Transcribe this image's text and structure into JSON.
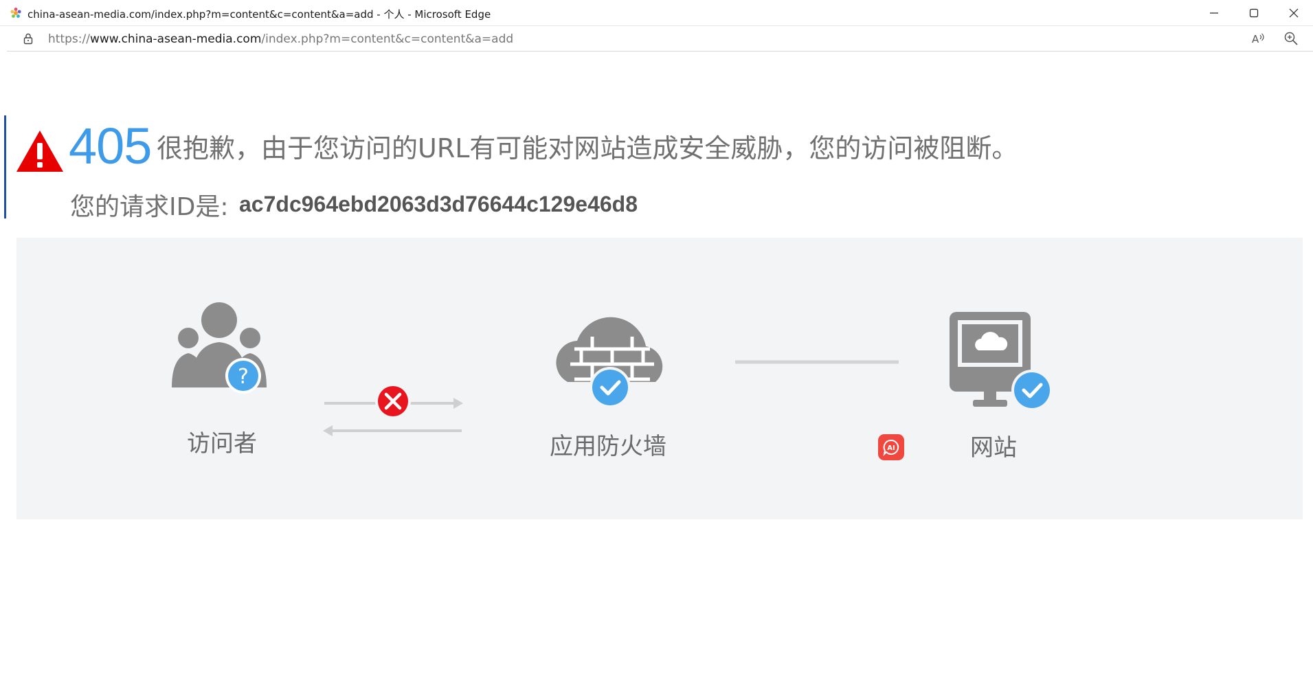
{
  "window": {
    "title": "china-asean-media.com/index.php?m=content&c=content&a=add - 个人 - Microsoft Edge"
  },
  "address_bar": {
    "url_scheme": "https://",
    "url_host": "www.china-asean-media.com",
    "url_path": "/index.php?m=content&c=content&a=add"
  },
  "error": {
    "code": "405",
    "message": "很抱歉，由于您访问的URL有可能对网站造成安全威胁，您的访问被阻断。",
    "request_id_label": "您的请求ID是:",
    "request_id": "ac7dc964ebd2063d3d76644c129e46d8"
  },
  "diagram": {
    "visitor_label": "访问者",
    "firewall_label": "应用防火墙",
    "website_label": "网站"
  },
  "icons": {
    "favicon": "edge-site-icon",
    "lock": "lock-icon",
    "read_aloud": "read-aloud-icon",
    "zoom": "zoom-icon",
    "warning": "warning-triangle-icon",
    "ai": "ai-assistant-icon"
  },
  "colors": {
    "code_blue": "#3d9be9",
    "warning_red": "#e60000",
    "block_red": "#e8141e",
    "check_blue": "#4aa6ea",
    "icon_gray": "#8c8c8c",
    "panel_bg": "#f3f4f5"
  }
}
